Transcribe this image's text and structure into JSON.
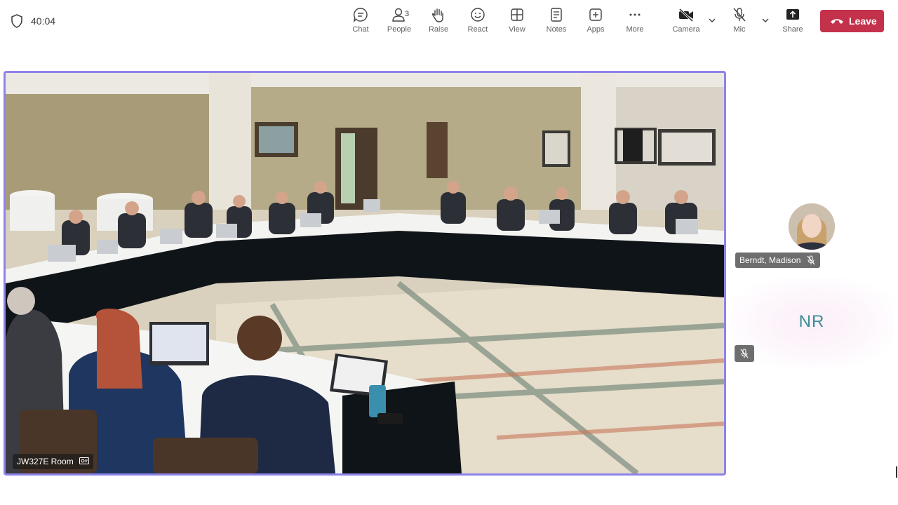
{
  "meeting": {
    "timer": "40:04"
  },
  "toolbar": {
    "chat": "Chat",
    "people": "People",
    "people_count": "3",
    "raise": "Raise",
    "react": "React",
    "view": "View",
    "notes": "Notes",
    "apps": "Apps",
    "more": "More",
    "camera": "Camera",
    "mic": "Mic",
    "share": "Share",
    "leave": "Leave"
  },
  "stage": {
    "room_name": "JW327E Room"
  },
  "participants": [
    {
      "name": "Berndt, Madison",
      "muted": true
    },
    {
      "initials": "NR",
      "muted": true
    }
  ],
  "colors": {
    "leave": "#c4314b",
    "active_border": "#8e83e8",
    "initials": "#3b8e96"
  }
}
